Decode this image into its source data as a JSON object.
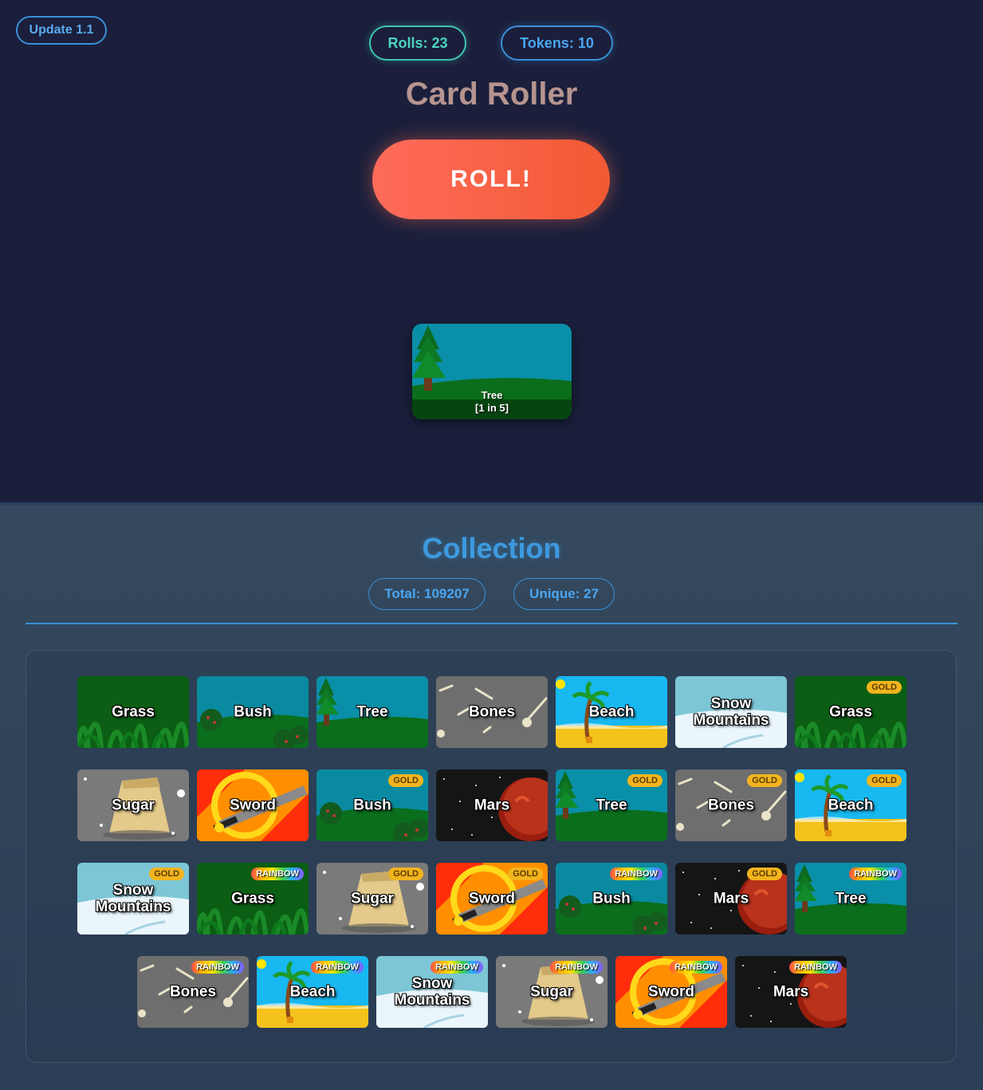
{
  "header": {
    "update_label": "Update 1.1",
    "rolls_label": "Rolls: 23",
    "tokens_label": "Tokens: 10",
    "title": "Card Roller",
    "roll_button": "ROLL!"
  },
  "rolled_card": {
    "name": "Tree",
    "odds": "[1 in 5]"
  },
  "collection": {
    "title": "Collection",
    "total_label": "Total: 109207",
    "unique_label": "Unique: 27",
    "cards": [
      {
        "name": "Grass",
        "theme": "grass",
        "tier": ""
      },
      {
        "name": "Bush",
        "theme": "bush",
        "tier": ""
      },
      {
        "name": "Tree",
        "theme": "tree",
        "tier": ""
      },
      {
        "name": "Bones",
        "theme": "bones",
        "tier": ""
      },
      {
        "name": "Beach",
        "theme": "beach",
        "tier": ""
      },
      {
        "name": "Snow Mountains",
        "theme": "snow",
        "tier": ""
      },
      {
        "name": "Grass",
        "theme": "grass",
        "tier": "GOLD"
      },
      {
        "name": "Sugar",
        "theme": "sugar",
        "tier": ""
      },
      {
        "name": "Sword",
        "theme": "sword",
        "tier": ""
      },
      {
        "name": "Bush",
        "theme": "bush",
        "tier": "GOLD"
      },
      {
        "name": "Mars",
        "theme": "mars",
        "tier": ""
      },
      {
        "name": "Tree",
        "theme": "tree",
        "tier": "GOLD"
      },
      {
        "name": "Bones",
        "theme": "bones",
        "tier": "GOLD"
      },
      {
        "name": "Beach",
        "theme": "beach",
        "tier": "GOLD"
      },
      {
        "name": "Snow Mountains",
        "theme": "snow",
        "tier": "GOLD"
      },
      {
        "name": "Grass",
        "theme": "grass",
        "tier": "RAINBOW"
      },
      {
        "name": "Sugar",
        "theme": "sugar",
        "tier": "GOLD"
      },
      {
        "name": "Sword",
        "theme": "sword",
        "tier": "GOLD"
      },
      {
        "name": "Bush",
        "theme": "bush",
        "tier": "RAINBOW"
      },
      {
        "name": "Mars",
        "theme": "mars",
        "tier": "GOLD"
      },
      {
        "name": "Tree",
        "theme": "tree",
        "tier": "RAINBOW"
      },
      {
        "name": "Bones",
        "theme": "bones",
        "tier": "RAINBOW"
      },
      {
        "name": "Beach",
        "theme": "beach",
        "tier": "RAINBOW"
      },
      {
        "name": "Snow Mountains",
        "theme": "snow",
        "tier": "RAINBOW"
      },
      {
        "name": "Sugar",
        "theme": "sugar",
        "tier": "RAINBOW"
      },
      {
        "name": "Sword",
        "theme": "sword",
        "tier": "RAINBOW"
      },
      {
        "name": "Mars",
        "theme": "mars",
        "tier": "RAINBOW"
      }
    ]
  }
}
